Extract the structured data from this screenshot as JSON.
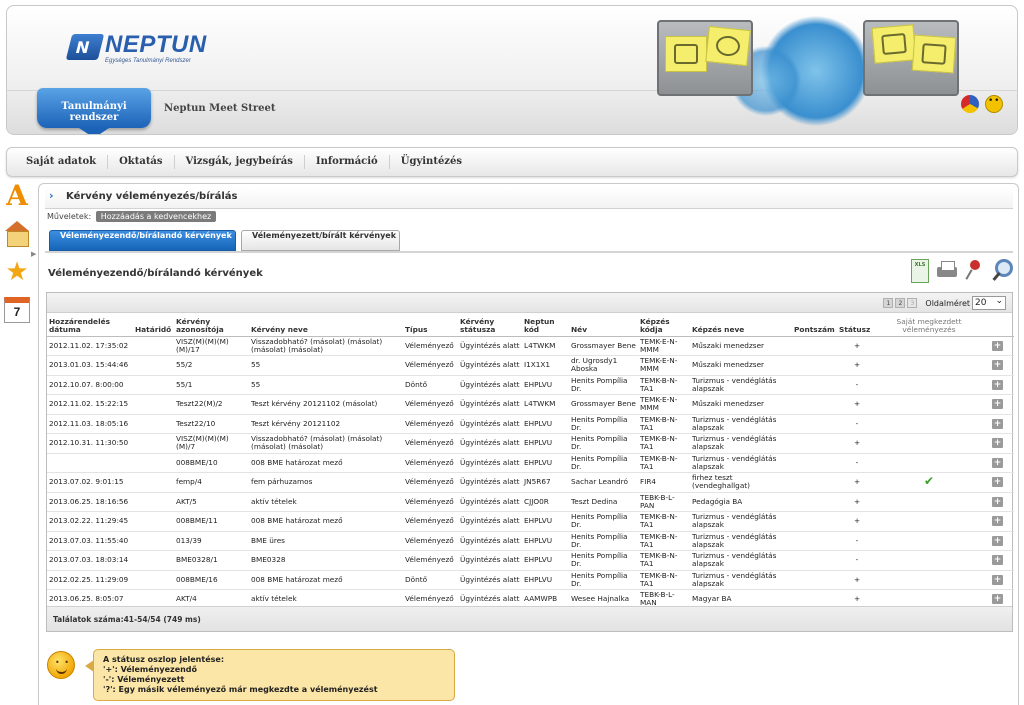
{
  "header": {
    "logo_text": "NEPTUN",
    "logo_tagline": "Egységes Tanulmányi Rendszer",
    "system_tab": "Tanulmányi rendszer",
    "meet_street": "Neptun Meet Street"
  },
  "menu": [
    "Saját adatok",
    "Oktatás",
    "Vizsgák, jegybeírás",
    "Információ",
    "Ügyintézés"
  ],
  "side": {
    "calendar_day": "7"
  },
  "page": {
    "title": "Kérvény véleményezés/bírálás",
    "ops_label": "Műveletek:",
    "fav_button": "Hozzáadás a kedvencekhez",
    "tab_active": "Véleményezendő/bírálandó kérvények",
    "tab_inactive": "Véleményezett/bírált kérvények",
    "section_title": "Véleményezendő/bírálandó kérvények"
  },
  "pager": {
    "pages": [
      "1",
      "2",
      "3"
    ],
    "page_size_label": "Oldalméret",
    "page_size": "20"
  },
  "columns": [
    "Hozzárendelés dátuma",
    "Határidő",
    "Kérvény azonosítója",
    "Kérvény neve",
    "Típus",
    "Kérvény státusza",
    "Neptun kód",
    "Név",
    "Képzés kódja",
    "Képzés neve",
    "Pontszám",
    "Státusz",
    "Saját megkezdett véleményezés",
    ""
  ],
  "rows": [
    [
      "2012.11.02. 17:35:02",
      "",
      "VISZ(M)(M)(M)(M)/17",
      "Visszadobható? (másolat) (másolat) (másolat) (másolat)",
      "Véleményező",
      "Ügyintézés alatt",
      "L4TWKM",
      "Grossmayer Bene",
      "TEMK-E-N-MMM",
      "Műszaki menedzser",
      "",
      "+",
      "",
      "+"
    ],
    [
      "2013.01.03. 15:44:46",
      "",
      "55/2",
      "55",
      "Véleményező",
      "Ügyintézés alatt",
      "I1X1X1",
      "dr. Ugrosdy1 Aboska",
      "TEMK-E-N-MMM",
      "Műszaki menedzser",
      "",
      "+",
      "",
      "+"
    ],
    [
      "2012.10.07. 8:00:00",
      "",
      "55/1",
      "55",
      "Döntő",
      "Ügyintézés alatt",
      "EHPLVU",
      "Henits Pompília Dr.",
      "TEMK-B-N-TA1",
      "Turizmus - vendéglátás alapszak",
      "",
      "-",
      "",
      "+"
    ],
    [
      "2012.11.02. 15:22:15",
      "",
      "Teszt22(M)/2",
      "Teszt kérvény 20121102 (másolat)",
      "Véleményező",
      "Ügyintézés alatt",
      "L4TWKM",
      "Grossmayer Bene",
      "TEMK-E-N-MMM",
      "Műszaki menedzser",
      "",
      "+",
      "",
      "+"
    ],
    [
      "2012.11.03. 18:05:16",
      "",
      "Teszt22/10",
      "Teszt kérvény 20121102",
      "Véleményező",
      "Ügyintézés alatt",
      "EHPLVU",
      "Henits Pompília Dr.",
      "TEMK-B-N-TA1",
      "Turizmus - vendéglátás alapszak",
      "",
      "-",
      "",
      "+"
    ],
    [
      "2012.10.31. 11:30:50",
      "",
      "VISZ(M)(M)(M)(M)/7",
      "Visszadobható? (másolat) (másolat) (másolat) (másolat)",
      "Véleményező",
      "Ügyintézés alatt",
      "EHPLVU",
      "Henits Pompília Dr.",
      "TEMK-B-N-TA1",
      "Turizmus - vendéglátás alapszak",
      "",
      "+",
      "",
      "+"
    ],
    [
      "",
      "",
      "008BME/10",
      "008 BME határozat mező",
      "Véleményező",
      "Ügyintézés alatt",
      "EHPLVU",
      "Henits Pompília Dr.",
      "TEMK-B-N-TA1",
      "Turizmus - vendéglátás alapszak",
      "",
      "-",
      "",
      "+"
    ],
    [
      "2013.07.02. 9:01:15",
      "",
      "femp/4",
      "fem párhuzamos",
      "Véleményező",
      "Ügyintézés alatt",
      "JN5R67",
      "Sachar Leandró",
      "FIR4",
      "firhez teszt (vendeghallgat)",
      "",
      "+",
      "✔",
      "+"
    ],
    [
      "2013.06.25. 18:16:56",
      "",
      "AKT/5",
      "aktív tételek",
      "Véleményező",
      "Ügyintézés alatt",
      "CJJO0R",
      "Teszt Dedina",
      "TEBK-B-L-PAN",
      "Pedagógia BA",
      "",
      "+",
      "",
      "+"
    ],
    [
      "2013.02.22. 11:29:45",
      "",
      "008BME/11",
      "008 BME határozat mező",
      "Véleményező",
      "Ügyintézés alatt",
      "EHPLVU",
      "Henits Pompília Dr.",
      "TEMK-B-N-TA1",
      "Turizmus - vendéglátás alapszak",
      "",
      "+",
      "",
      "+"
    ],
    [
      "2013.07.03. 11:55:40",
      "",
      "013/39",
      "BME üres",
      "Véleményező",
      "Ügyintézés alatt",
      "EHPLVU",
      "Henits Pompília Dr.",
      "TEMK-B-N-TA1",
      "Turizmus - vendéglátás alapszak",
      "",
      "-",
      "",
      "+"
    ],
    [
      "2013.07.03. 18:03:14",
      "",
      "BME0328/1",
      "BME0328",
      "Véleményező",
      "Ügyintézés alatt",
      "EHPLVU",
      "Henits Pompília Dr.",
      "TEMK-B-N-TA1",
      "Turizmus - vendéglátás alapszak",
      "",
      "-",
      "",
      "+"
    ],
    [
      "2012.02.25. 11:29:09",
      "",
      "008BME/16",
      "008 BME határozat mező",
      "Döntő",
      "Ügyintézés alatt",
      "EHPLVU",
      "Henits Pompília Dr.",
      "TEMK-B-N-TA1",
      "Turizmus - vendéglátás alapszak",
      "",
      "+",
      "",
      "+"
    ],
    [
      "2013.06.25. 8:05:07",
      "",
      "AKT/4",
      "aktív tételek",
      "Véleményező",
      "Ügyintézés alatt",
      "AAMWPB",
      "Wesee Hajnalka",
      "TEBK-B-L-MAN",
      "Magyar BA",
      "",
      "+",
      "",
      "+"
    ]
  ],
  "result_count": "Találatok száma:41-54/54 (749 ms)",
  "legend": {
    "title": "A státusz oszlop jelentése:",
    "lines": [
      "'+': Véleményezendő",
      "'-': Véleményezett",
      "'?': Egy másik véleményező már megkezdte a véleményezést"
    ]
  },
  "colors": {
    "accent_blue": "#1c63b8",
    "legend_bg": "#fbe6a7",
    "check_green": "#3aa02a"
  }
}
